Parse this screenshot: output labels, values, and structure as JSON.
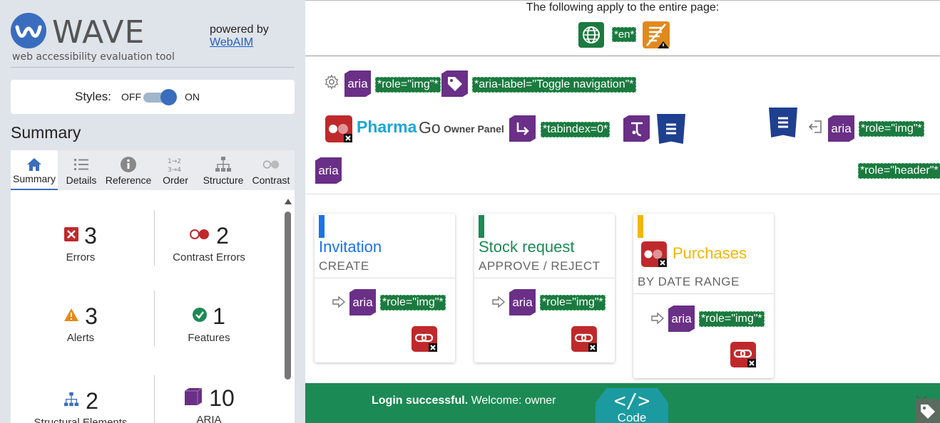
{
  "sidebar": {
    "brand": "WAVE",
    "tagline": "web accessibility evaluation tool",
    "powered_by": "powered by",
    "powered_link": "WebAIM",
    "styles_label": "Styles:",
    "styles_off": "OFF",
    "styles_on": "ON",
    "summary_heading": "Summary",
    "tabs": [
      {
        "label": "Summary",
        "icon": "home-icon",
        "active": true
      },
      {
        "label": "Details",
        "icon": "list-icon"
      },
      {
        "label": "Reference",
        "icon": "info-icon"
      },
      {
        "label": "Order",
        "icon": "order-icon"
      },
      {
        "label": "Structure",
        "icon": "structure-icon"
      },
      {
        "label": "Contrast",
        "icon": "contrast-icon"
      }
    ],
    "stats": {
      "errors": {
        "count": "3",
        "label": "Errors"
      },
      "contrast": {
        "count": "2",
        "label": "Contrast Errors"
      },
      "alerts": {
        "count": "3",
        "label": "Alerts"
      },
      "features": {
        "count": "1",
        "label": "Features"
      },
      "structural": {
        "count": "2",
        "label": "Structural Elements"
      },
      "aria": {
        "count": "10",
        "label": "ARIA"
      }
    }
  },
  "page": {
    "notice": "The following apply to the entire page:",
    "lang_tag": "*en*",
    "tags": {
      "role_img": "*role=\"img\"*",
      "aria_label_toggle": "*aria-label=\"Toggle navigation\"*",
      "tabindex": "*tabindex=0*",
      "role_header": "*role=\"header\"*"
    },
    "aria_text": "aria",
    "brand_pharma": "Pharma",
    "brand_go": "Go",
    "owner_panel": "Owner Panel",
    "cards": [
      {
        "title": "Invitation",
        "subtitle": "CREATE",
        "color": "#1a73e8"
      },
      {
        "title": "Stock request",
        "subtitle": "APPROVE / REJECT",
        "color": "#1c8a54"
      },
      {
        "title": "Purchases",
        "subtitle": "BY DATE RANGE",
        "color": "#f2b705"
      }
    ],
    "banner_bold": "Login successful.",
    "banner_rest": " Welcome: owner",
    "code_label": "Code"
  },
  "colors": {
    "wave_blue": "#3a6dbd",
    "aria_purple": "#6a2f86",
    "tag_green": "#1b7a3f",
    "error_red": "#c0292b",
    "banner_green": "#1c8a54"
  }
}
